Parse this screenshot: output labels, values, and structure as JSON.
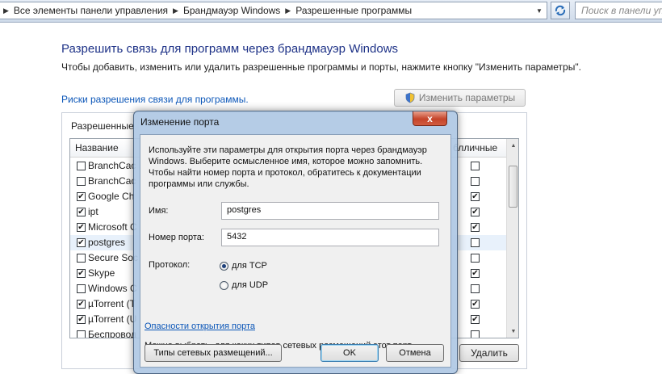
{
  "address_bar": {
    "crumbs": [
      "Все элементы панели управления",
      "Брандмауэр Windows",
      "Разрешенные программы"
    ],
    "search_placeholder": "Поиск в панели управления"
  },
  "page": {
    "title": "Разрешить связь для программ через брандмауэр Windows",
    "description": "Чтобы добавить, изменить или удалить разрешенные программы и порты, нажмите кнопку \"Изменить параметры\".",
    "risk_link": "Риски разрешения связи для программы.",
    "change_settings_button": "Изменить параметры",
    "group_label": "Разрешенные",
    "col_name": "Название",
    "col_public": "блличные",
    "rows": [
      {
        "name": "BranchCac",
        "checked": false,
        "public": false,
        "selected": false
      },
      {
        "name": "BranchCac",
        "checked": false,
        "public": false,
        "selected": false
      },
      {
        "name": "Google Ch",
        "checked": true,
        "public": true,
        "selected": false
      },
      {
        "name": "ipt",
        "checked": true,
        "public": true,
        "selected": false
      },
      {
        "name": "Microsoft C",
        "checked": true,
        "public": true,
        "selected": false
      },
      {
        "name": "postgres",
        "checked": true,
        "public": false,
        "selected": true
      },
      {
        "name": "Secure Soc",
        "checked": false,
        "public": false,
        "selected": false
      },
      {
        "name": "Skype",
        "checked": true,
        "public": true,
        "selected": false
      },
      {
        "name": "Windows C",
        "checked": false,
        "public": false,
        "selected": false
      },
      {
        "name": "µTorrent (T",
        "checked": true,
        "public": true,
        "selected": false
      },
      {
        "name": "µTorrent (U",
        "checked": true,
        "public": true,
        "selected": false
      },
      {
        "name": "Беспровод",
        "checked": false,
        "public": false,
        "selected": false
      }
    ],
    "remove_button": "Удалить"
  },
  "dialog": {
    "title": "Изменение порта",
    "close_label": "x",
    "description": "Используйте эти параметры для открытия порта через брандмауэр Windows. Выберите осмысленное имя, которое можно запомнить. Чтобы найти номер порта и протокол, обратитесь к документации программы или службы.",
    "name_label": "Имя:",
    "name_value": "postgres",
    "port_label": "Номер порта:",
    "port_value": "5432",
    "protocol_label": "Протокол:",
    "protocol_tcp": "для TCP",
    "protocol_udp": "для UDP",
    "selected_protocol": "tcp",
    "danger_link": "Опасности открытия порта",
    "network_note": "Можно выбрать, для каких типов сетевых размещений этот порт открыт.",
    "network_types_button": "Типы сетевых размещений...",
    "ok_button": "OK",
    "cancel_button": "Отмена"
  }
}
